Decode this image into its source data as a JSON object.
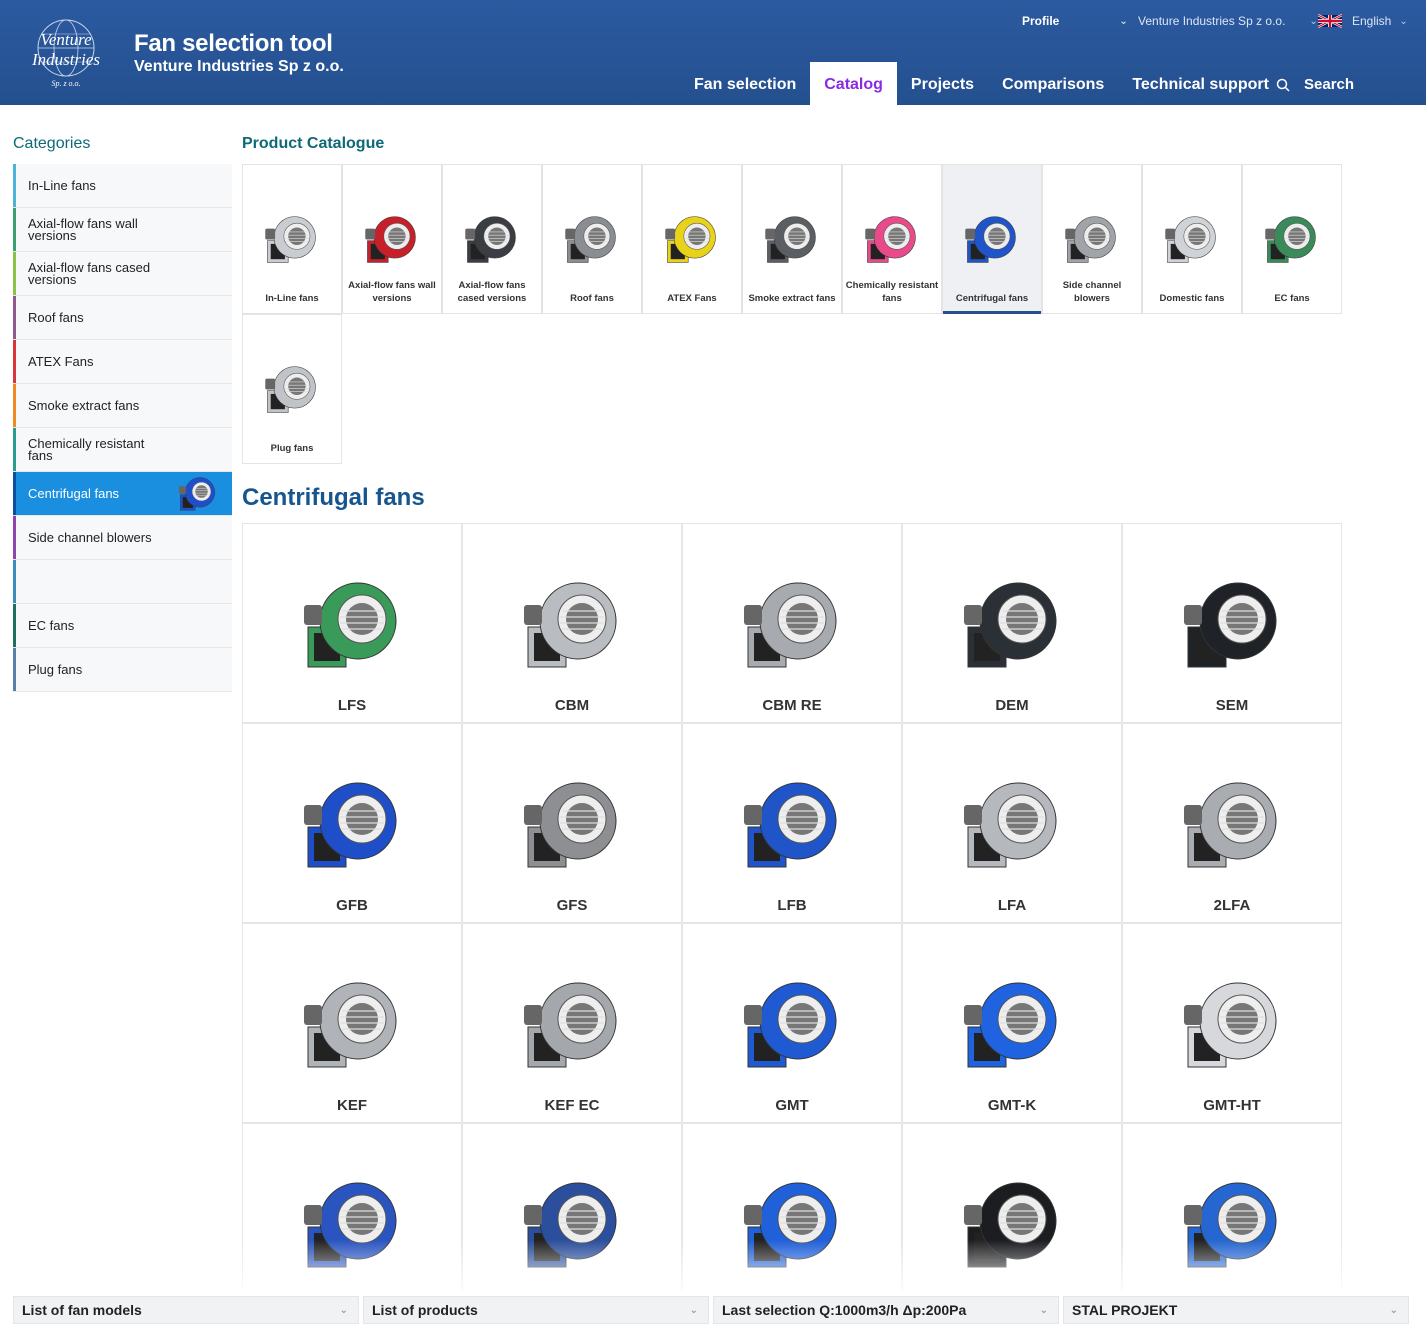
{
  "header": {
    "logo_text": [
      "Venture",
      "Industries",
      "Sp. z o.o."
    ],
    "app_title": "Fan selection tool",
    "company": "Venture Industries Sp z o.o.",
    "profile_label": "Profile",
    "account_label": "Venture Industries Sp z o.o.",
    "language_label": "English",
    "nav": [
      {
        "label": "Fan selection",
        "active": false
      },
      {
        "label": "Catalog",
        "active": true
      },
      {
        "label": "Projects",
        "active": false
      },
      {
        "label": "Comparisons",
        "active": false
      },
      {
        "label": "Technical support",
        "active": false
      }
    ],
    "search_label": "Search"
  },
  "sidebar": {
    "heading": "Categories",
    "items": [
      {
        "label": "In-Line fans",
        "color": "#4fb3d9"
      },
      {
        "label": "Axial-flow fans wall versions",
        "color": "#3a9f6e"
      },
      {
        "label": "Axial-flow fans cased versions",
        "color": "#8bc34a"
      },
      {
        "label": "Roof fans",
        "color": "#8e5a8c"
      },
      {
        "label": "ATEX Fans",
        "color": "#d9343a"
      },
      {
        "label": "Smoke extract fans",
        "color": "#f08a24"
      },
      {
        "label": "Chemically resistant fans",
        "color": "#2a9d8f"
      },
      {
        "label": "Centrifugal fans",
        "color": "#0a4f9e",
        "active": true
      },
      {
        "label": "Side channel blowers",
        "color": "#8e44ad"
      },
      {
        "label": "",
        "color": "#3c8dbc"
      },
      {
        "label": "EC fans",
        "color": "#1e6f5c"
      },
      {
        "label": "Plug fans",
        "color": "#5a7fa8"
      }
    ]
  },
  "catalogue": {
    "heading": "Product Catalogue",
    "tiles": [
      {
        "label": "In-Line fans"
      },
      {
        "label": "Axial-flow fans wall versions"
      },
      {
        "label": "Axial-flow fans cased versions"
      },
      {
        "label": "Roof fans"
      },
      {
        "label": "ATEX Fans"
      },
      {
        "label": "Smoke extract fans"
      },
      {
        "label": "Chemically resistant fans"
      },
      {
        "label": "Centrifugal fans",
        "active": true
      },
      {
        "label": "Side channel blowers"
      },
      {
        "label": "Domestic fans"
      },
      {
        "label": "EC fans"
      },
      {
        "label": "Plug fans"
      }
    ]
  },
  "section_title": "Centrifugal fans",
  "products": [
    {
      "name": "LFS",
      "color": "#3a9a5a"
    },
    {
      "name": "CBM",
      "color": "#b9bcc0"
    },
    {
      "name": "CBM RE",
      "color": "#a7abb0"
    },
    {
      "name": "DEM",
      "color": "#2b2f36"
    },
    {
      "name": "SEM",
      "color": "#1f2226"
    },
    {
      "name": "GFB",
      "color": "#1f4fc8"
    },
    {
      "name": "GFS",
      "color": "#8d8f93"
    },
    {
      "name": "LFB",
      "color": "#1f55c8"
    },
    {
      "name": "LFA",
      "color": "#b5b8bc"
    },
    {
      "name": "2LFA",
      "color": "#a9adb1"
    },
    {
      "name": "KEF",
      "color": "#b0b3b7"
    },
    {
      "name": "KEF EC",
      "color": "#a4a7ab"
    },
    {
      "name": "GMT",
      "color": "#1f5ad2"
    },
    {
      "name": "GMT-K",
      "color": "#1f63e0"
    },
    {
      "name": "GMT-HT",
      "color": "#d6d8db"
    },
    {
      "name": "",
      "color": "#2a55c0"
    },
    {
      "name": "",
      "color": "#2b4f9c"
    },
    {
      "name": "",
      "color": "#2060d8"
    },
    {
      "name": "",
      "color": "#1b1d21"
    },
    {
      "name": "",
      "color": "#2566d0"
    }
  ],
  "bottom_bar": [
    {
      "label": "List of fan models"
    },
    {
      "label": "List of products"
    },
    {
      "label": "Last selection Q:1000m3/h Δp:200Pa"
    },
    {
      "label": "STAL PROJEKT"
    }
  ]
}
